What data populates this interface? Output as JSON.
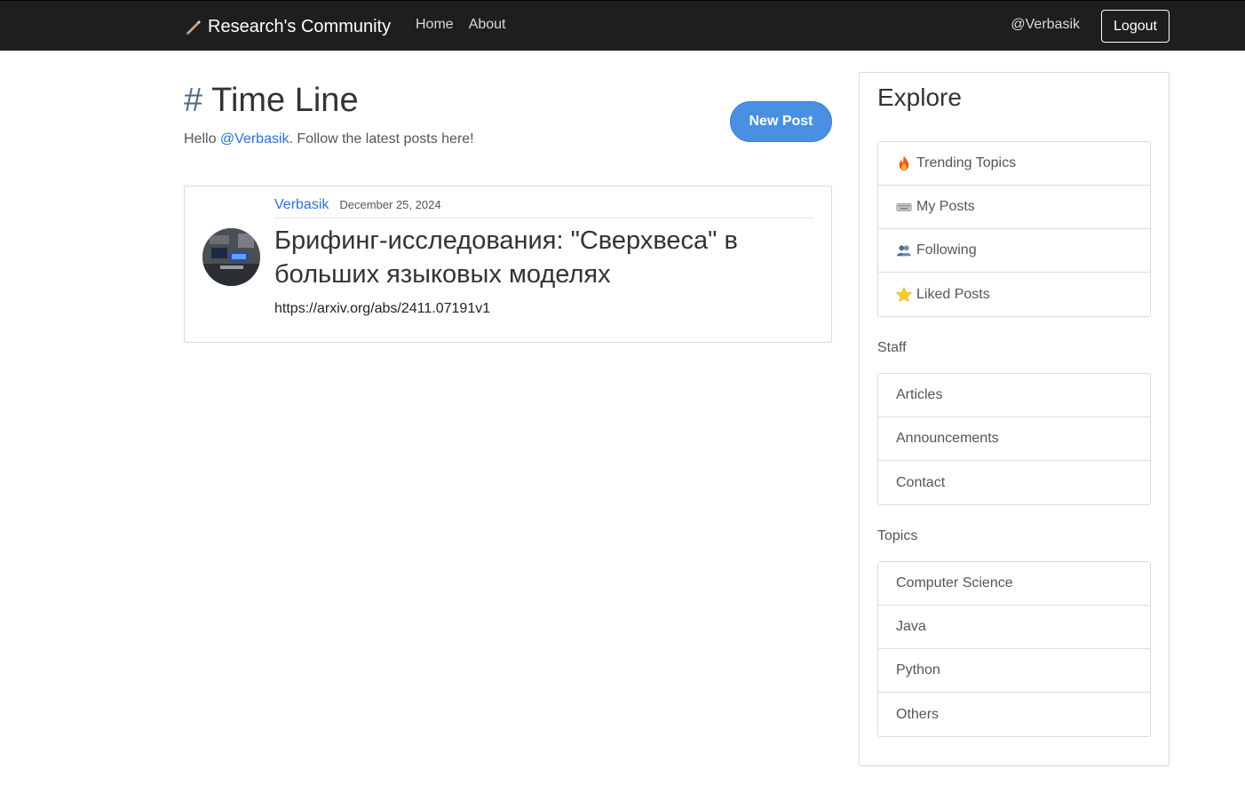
{
  "navbar": {
    "brand": "Research's Community",
    "links": [
      "Home",
      "About"
    ],
    "user": "@Verbasik",
    "logout": "Logout"
  },
  "main": {
    "title_hash": "#",
    "title": "Time Line",
    "greeting_prefix": "Hello ",
    "greeting_user": "@Verbasik",
    "greeting_suffix": ". Follow the latest posts here!",
    "new_post": "New Post"
  },
  "posts": [
    {
      "author": "Verbasik",
      "date": "December 25, 2024",
      "title": "Брифинг-исследования: \"Сверхвеса\" в больших языковых моделях",
      "link": "https://arxiv.org/abs/2411.07191v1"
    }
  ],
  "explore": {
    "title": "Explore",
    "items": [
      {
        "label": "Trending Topics",
        "icon": "fire-icon"
      },
      {
        "label": "My Posts",
        "icon": "keyboard-icon"
      },
      {
        "label": "Following",
        "icon": "people-icon"
      },
      {
        "label": "Liked Posts",
        "icon": "star-icon"
      }
    ],
    "staff_label": "Staff",
    "staff": [
      "Articles",
      "Announcements",
      "Contact"
    ],
    "topics_label": "Topics",
    "topics": [
      "Computer Science",
      "Java",
      "Python",
      "Others"
    ]
  },
  "colors": {
    "navbar_bg": "#1e1e20",
    "accent_button": "#4a90e2",
    "link": "#2a6fd6"
  }
}
